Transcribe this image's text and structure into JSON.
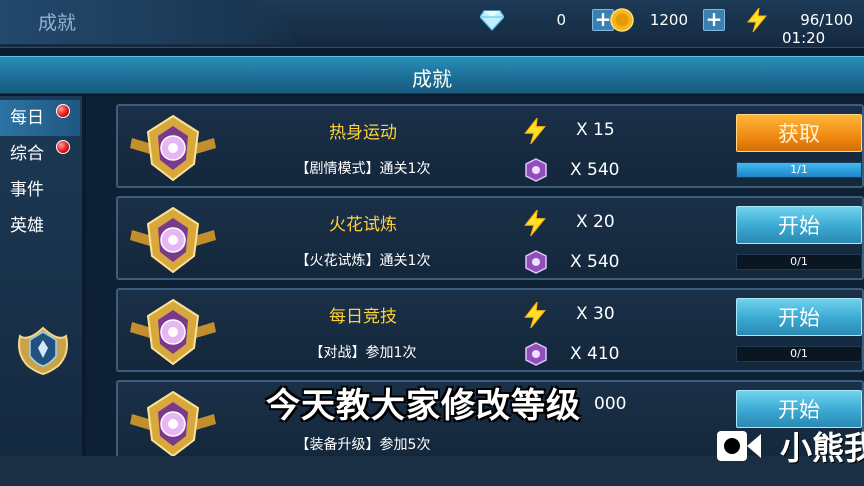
{
  "header": {
    "page_label": "成就",
    "gems": "0",
    "coins": "1200",
    "energy": "96/100",
    "timer": "01:20"
  },
  "title": "成就",
  "tabs": [
    {
      "label": "每日",
      "active": true,
      "badge": true
    },
    {
      "label": "综合",
      "active": false,
      "badge": true
    },
    {
      "label": "事件",
      "active": false,
      "badge": false
    },
    {
      "label": "英雄",
      "active": false,
      "badge": false
    }
  ],
  "tasks": [
    {
      "title": "热身运动",
      "desc": "【剧情模式】通关1次",
      "energy_reward": "X 15",
      "gem_reward": "X 540",
      "button": "获取",
      "button_type": "claim",
      "progress": "1/1",
      "progress_fraction": 1.0
    },
    {
      "title": "火花试炼",
      "desc": "【火花试炼】通关1次",
      "energy_reward": "X 20",
      "gem_reward": "X 540",
      "button": "开始",
      "button_type": "start",
      "progress": "0/1",
      "progress_fraction": 0.0
    },
    {
      "title": "每日竞技",
      "desc": "【对战】参加1次",
      "energy_reward": "X 30",
      "gem_reward": "X 410",
      "button": "开始",
      "button_type": "start",
      "progress": "0/1",
      "progress_fraction": 0.0
    },
    {
      "title": "",
      "desc": "【装备升级】参加5次",
      "energy_reward": "",
      "gem_reward": "000",
      "button": "开始",
      "button_type": "start",
      "progress": "",
      "progress_fraction": 0.0
    }
  ],
  "overlay": {
    "subtitle": "今天教大家修改等级",
    "watermark": "小熊我"
  },
  "colors": {
    "title_gold": "#ffd23a",
    "claim_orange": "#f08a12",
    "start_cyan": "#3aa8d2"
  },
  "icons": {
    "gem": "diamond-icon",
    "coin": "coin-icon",
    "energy": "lightning-icon",
    "medal": "medal-icon"
  }
}
